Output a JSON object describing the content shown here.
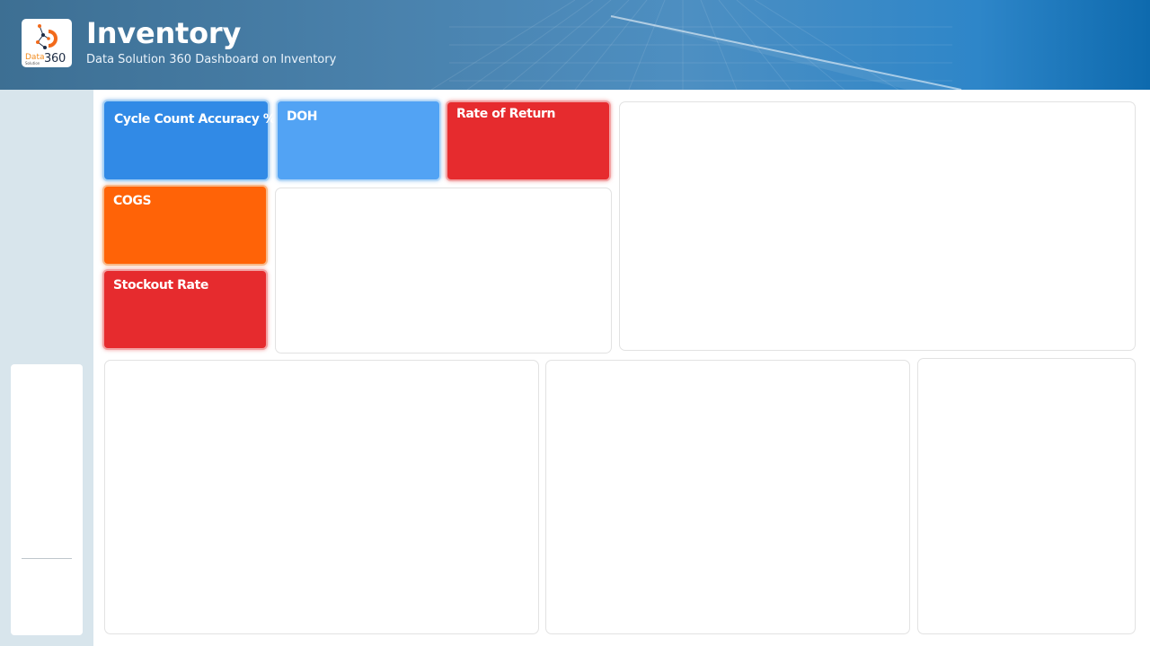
{
  "header": {
    "title": "Inventory",
    "subtitle": "Data Solution 360 Dashboard on Inventory",
    "logo": {
      "word": "Data",
      "sub": "Solution",
      "number": "360"
    }
  },
  "kpis": {
    "cycle_count": "Cycle Count Accuracy %",
    "doh": "DOH",
    "rate_of_return": "Rate of Return",
    "cogs": "COGS",
    "stockout_rate": "Stockout Rate"
  },
  "colors": {
    "header_accent": "#2e86c9",
    "kpi_blue": "#318ae6",
    "kpi_light_blue": "#52a3f4",
    "kpi_red": "#e62b2e",
    "kpi_orange": "#ff6307",
    "rail_background": "#d8e5ec"
  }
}
